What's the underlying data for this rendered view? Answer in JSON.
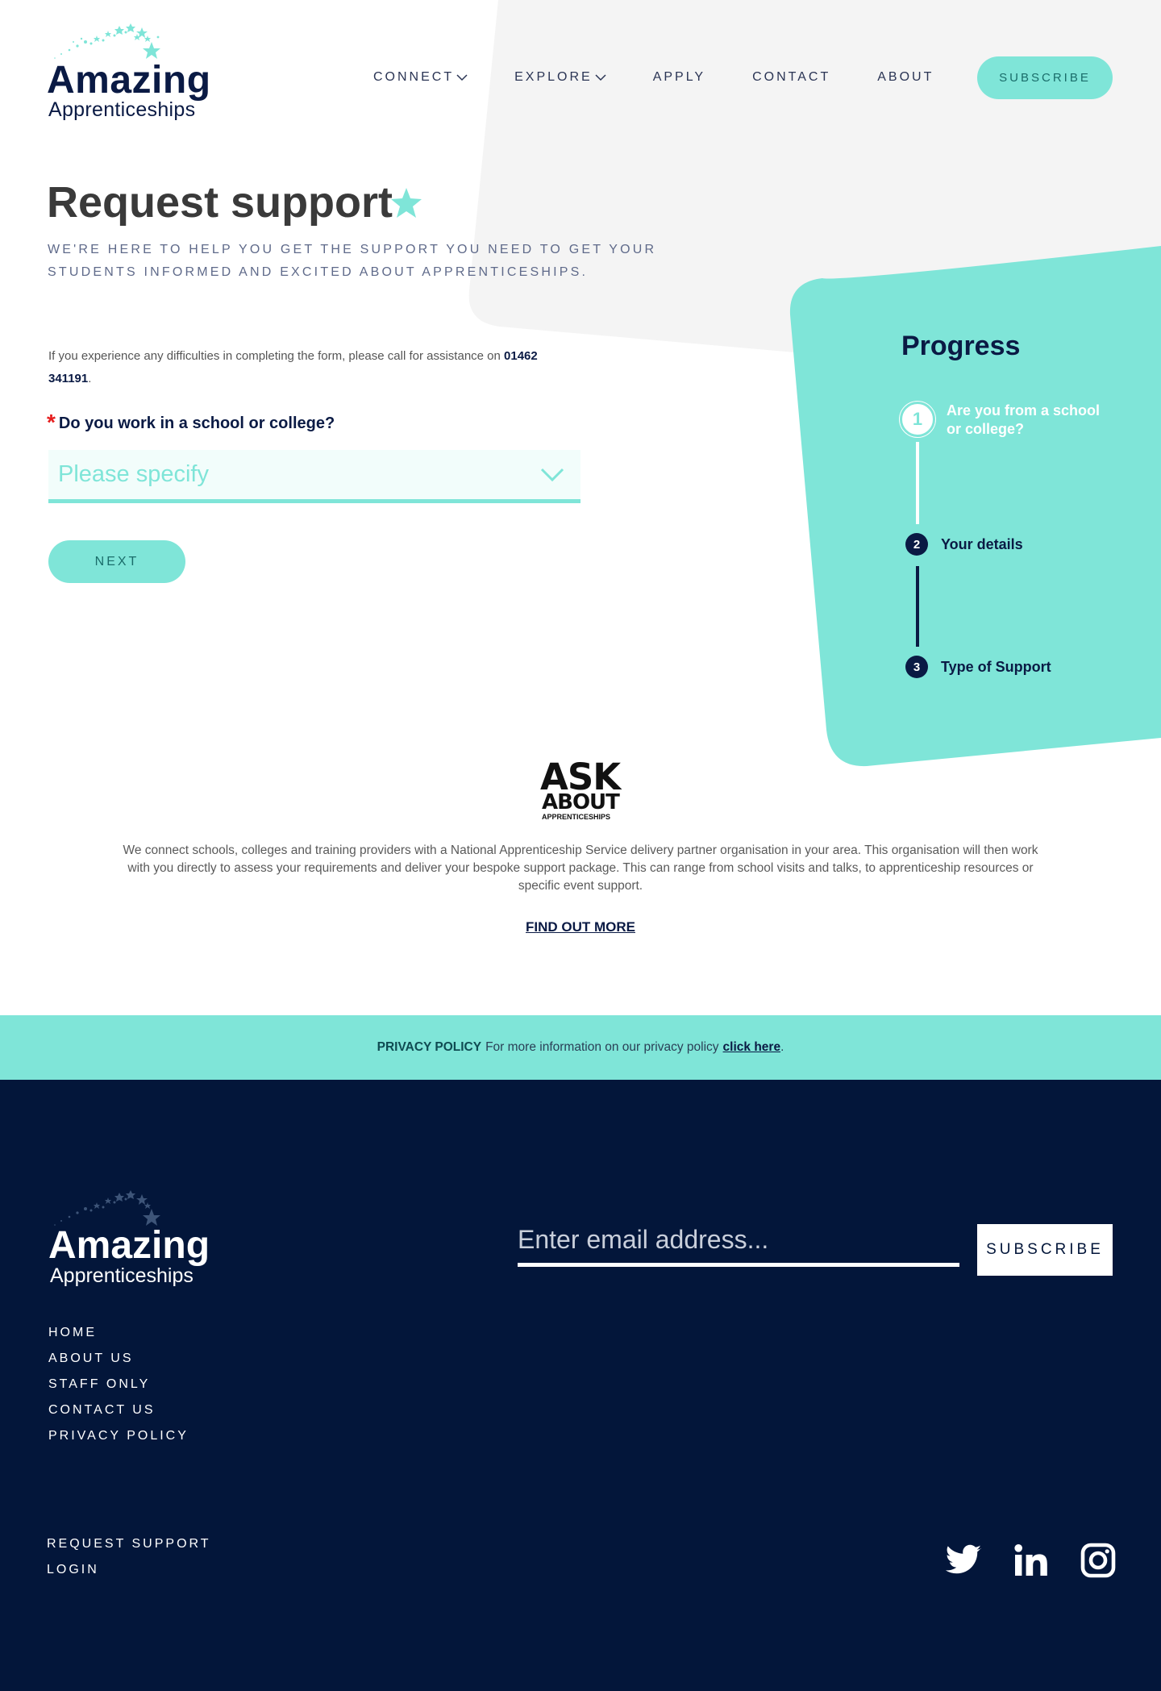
{
  "brand": {
    "name_line1": "Amazing",
    "name_line2": "Apprenticeships"
  },
  "nav": {
    "items": [
      {
        "label": "CONNECT",
        "has_dropdown": true
      },
      {
        "label": "EXPLORE",
        "has_dropdown": true
      },
      {
        "label": "APPLY",
        "has_dropdown": false
      },
      {
        "label": "CONTACT",
        "has_dropdown": false
      },
      {
        "label": "ABOUT",
        "has_dropdown": false
      }
    ],
    "subscribe_label": "SUBSCRIBE"
  },
  "hero": {
    "title": "Request support",
    "subtitle": "WE'RE HERE TO HELP YOU GET THE SUPPORT YOU NEED TO GET YOUR STUDENTS INFORMED AND EXCITED ABOUT APPRENTICESHIPS."
  },
  "form": {
    "assist_text": "If you experience any difficulties in completing the form, please call for assistance on",
    "phone": "01462 341191",
    "assist_suffix": ".",
    "required_marker": "*",
    "question": "Do you work in a school or college?",
    "select_placeholder": "Please specify",
    "next_label": "NEXT"
  },
  "progress": {
    "title": "Progress",
    "steps": [
      {
        "number": "1",
        "label_line1": "Are you from a school",
        "label_line2": "or college?",
        "active": true
      },
      {
        "number": "2",
        "label_line1": "Your details",
        "label_line2": "",
        "active": false
      },
      {
        "number": "3",
        "label_line1": "Type of Support",
        "label_line2": "",
        "active": false
      }
    ]
  },
  "ask_about": {
    "logo_line1": "ASK",
    "logo_line2": "ABOUT",
    "logo_line3": "APPRENTICESHIPS",
    "description": "We connect schools, colleges and training providers with a National Apprenticeship Service delivery partner organisation in your area. This organisation will then work with you directly to assess your requirements and deliver your bespoke support package. This can range from school visits and talks, to apprenticeship resources or specific event support.",
    "link_label": "FIND OUT MORE"
  },
  "privacy": {
    "heading": "PRIVACY POLICY",
    "text": "For more information on our privacy policy",
    "link_label": "click here",
    "suffix": "."
  },
  "footer": {
    "links": [
      "HOME",
      "ABOUT US",
      "STAFF ONLY",
      "CONTACT US",
      "PRIVACY POLICY"
    ],
    "links_secondary": [
      "REQUEST SUPPORT",
      "LOGIN"
    ],
    "email_placeholder": "Enter email address...",
    "subscribe_label": "SUBSCRIBE",
    "social_icons": [
      "twitter-icon",
      "linkedin-icon",
      "instagram-icon"
    ]
  },
  "colors": {
    "accent": "#7fe5d8",
    "navy": "#03163a",
    "title": "#3a3a3a",
    "required": "#e61e1e"
  }
}
